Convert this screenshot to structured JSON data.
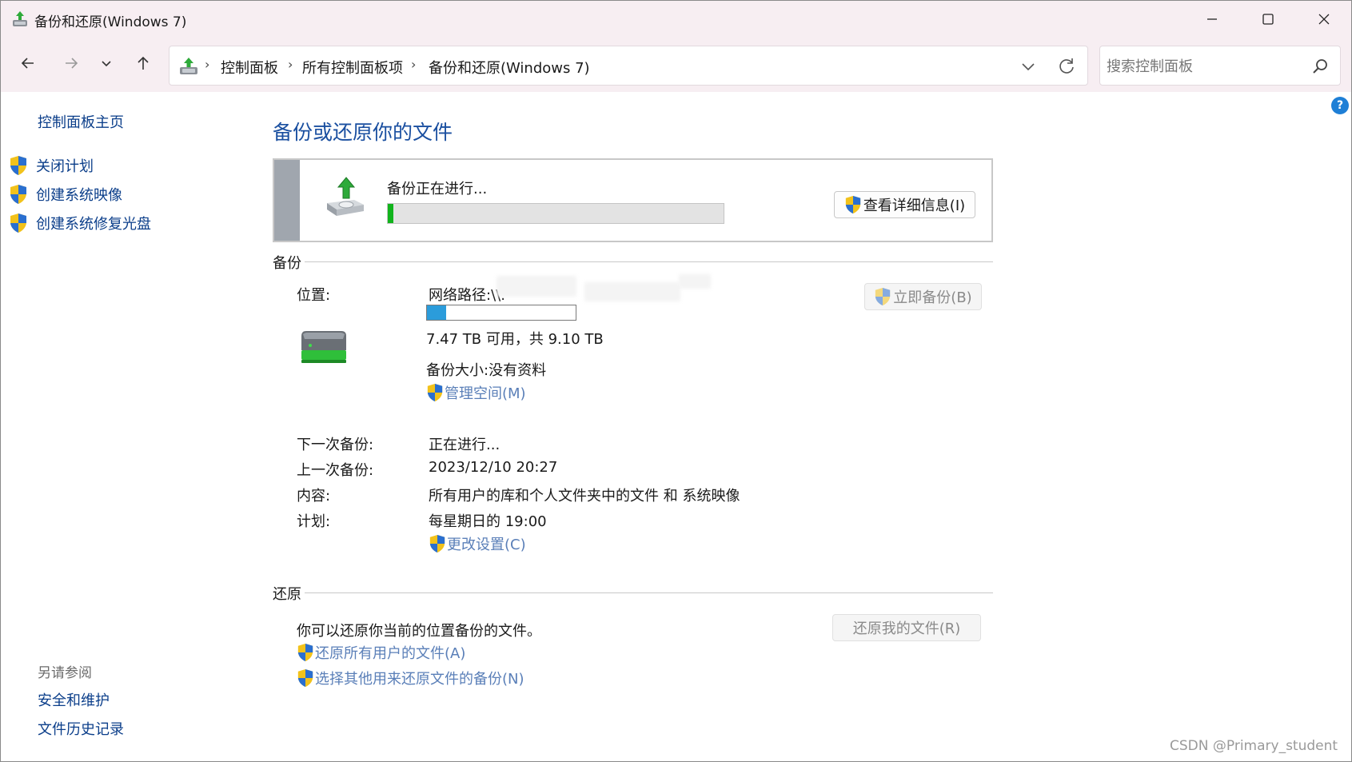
{
  "window": {
    "title": "备份和还原(Windows 7)",
    "controls": {
      "minimize": "—",
      "maximize": "☐",
      "close": "✕"
    }
  },
  "nav": {
    "breadcrumb": [
      "控制面板",
      "所有控制面板项",
      "备份和还原(Windows 7)"
    ],
    "search_placeholder": "搜索控制面板"
  },
  "sidebar": {
    "home": "控制面板主页",
    "tasks": [
      "关闭计划",
      "创建系统映像",
      "创建系统修复光盘"
    ],
    "see_also_heading": "另请参阅",
    "see_also": [
      "安全和维护",
      "文件历史记录"
    ]
  },
  "main": {
    "title": "备份或还原你的文件",
    "progress": {
      "status": "备份正在进行...",
      "fraction": 0.017,
      "details_button": "查看详细信息(I)"
    },
    "backup": {
      "section": "备份",
      "location_label": "位置:",
      "location_value": "网络路径:\\\\.",
      "capacity_fraction": 0.13,
      "free_space": "7.47 TB 可用，共 9.10 TB",
      "backup_size": "备份大小:没有资料",
      "manage_space": "管理空间(M)",
      "backup_now_button": "立即备份(B)",
      "next_backup_label": "下一次备份:",
      "next_backup_value": "正在进行...",
      "last_backup_label": "上一次备份:",
      "last_backup_value": "2023/12/10 20:27",
      "contents_label": "内容:",
      "contents_value": "所有用户的库和个人文件夹中的文件 和 系统映像",
      "schedule_label": "计划:",
      "schedule_value": "每星期日的 19:00",
      "change_settings": "更改设置(C)"
    },
    "restore": {
      "section": "还原",
      "description": "你可以还原你当前的位置备份的文件。",
      "restore_my_files_button": "还原我的文件(R)",
      "restore_all_users": "还原所有用户的文件(A)",
      "select_other_backup": "选择其他用来还原文件的备份(N)"
    }
  },
  "watermark": "CSDN @Primary_student",
  "colors": {
    "accent_link": "#0b3e8a",
    "title_blue": "#1a4fa0",
    "progress_green": "#11b41c",
    "capacity_blue": "#2b9cdb",
    "titlebar_bg": "#f7eef2"
  }
}
